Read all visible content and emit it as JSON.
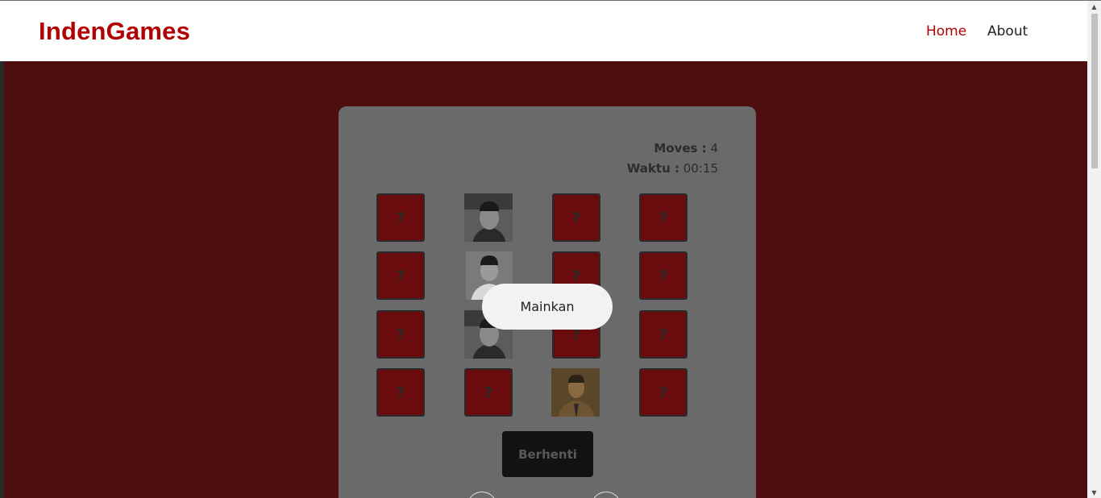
{
  "navbar": {
    "brand": "IndenGames",
    "links": [
      {
        "label": "Home",
        "active": true
      },
      {
        "label": "About",
        "active": false
      }
    ]
  },
  "colors": {
    "brand": "#b00000",
    "background": "#4e0e10",
    "card_back": "#6a0c0e"
  },
  "game": {
    "moves_label": "Moves :",
    "moves_value": "4",
    "time_label": "Waktu :",
    "time_value": "00:15",
    "card_back_symbol": "?",
    "cards": [
      {
        "state": "hidden"
      },
      {
        "state": "revealed",
        "image": "portrait-man-peci"
      },
      {
        "state": "hidden"
      },
      {
        "state": "hidden"
      },
      {
        "state": "hidden"
      },
      {
        "state": "revealed",
        "image": "portrait-man-peci-2"
      },
      {
        "state": "hidden"
      },
      {
        "state": "hidden"
      },
      {
        "state": "hidden"
      },
      {
        "state": "revealed",
        "image": "portrait-man-peci"
      },
      {
        "state": "hidden"
      },
      {
        "state": "hidden"
      },
      {
        "state": "hidden"
      },
      {
        "state": "hidden"
      },
      {
        "state": "revealed",
        "image": "portrait-man-sepia"
      },
      {
        "state": "hidden"
      }
    ],
    "stop_label": "Berhenti",
    "play_label": "Mainkan"
  }
}
